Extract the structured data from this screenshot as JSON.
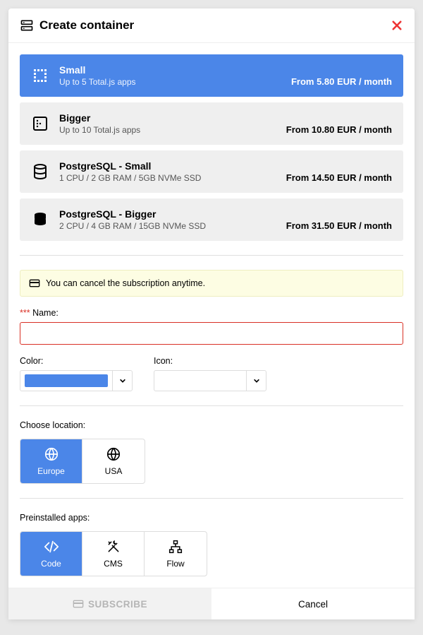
{
  "header": {
    "title": "Create container"
  },
  "plans": [
    {
      "name": "Small",
      "desc": "Up to 5 Total.js apps",
      "price": "From 5.80 EUR / month",
      "selected": true,
      "icon": "grid-icon"
    },
    {
      "name": "Bigger",
      "desc": "Up to 10 Total.js apps",
      "price": "From 10.80 EUR / month",
      "selected": false,
      "icon": "server-icon"
    },
    {
      "name": "PostgreSQL - Small",
      "desc": "1 CPU / 2 GB RAM / 5GB NVMe SSD",
      "price": "From 14.50 EUR / month",
      "selected": false,
      "icon": "database-icon"
    },
    {
      "name": "PostgreSQL - Bigger",
      "desc": "2 CPU / 4 GB RAM / 15GB NVMe SSD",
      "price": "From 31.50 EUR / month",
      "selected": false,
      "icon": "database-solid-icon"
    }
  ],
  "notice": {
    "text": "You can cancel the subscription anytime."
  },
  "fields": {
    "name_label": "Name:",
    "name_value": "",
    "color_label": "Color:",
    "color_value": "#4b86e8",
    "icon_label": "Icon:"
  },
  "location": {
    "label": "Choose location:",
    "options": [
      {
        "label": "Europe",
        "icon": "globe-icon",
        "selected": true
      },
      {
        "label": "USA",
        "icon": "globe-icon",
        "selected": false
      }
    ]
  },
  "apps": {
    "label": "Preinstalled apps:",
    "options": [
      {
        "label": "Code",
        "icon": "code-icon",
        "selected": true
      },
      {
        "label": "CMS",
        "icon": "tools-icon",
        "selected": false
      },
      {
        "label": "Flow",
        "icon": "flow-icon",
        "selected": false
      }
    ]
  },
  "footer": {
    "subscribe": "SUBSCRIBE",
    "cancel": "Cancel"
  }
}
